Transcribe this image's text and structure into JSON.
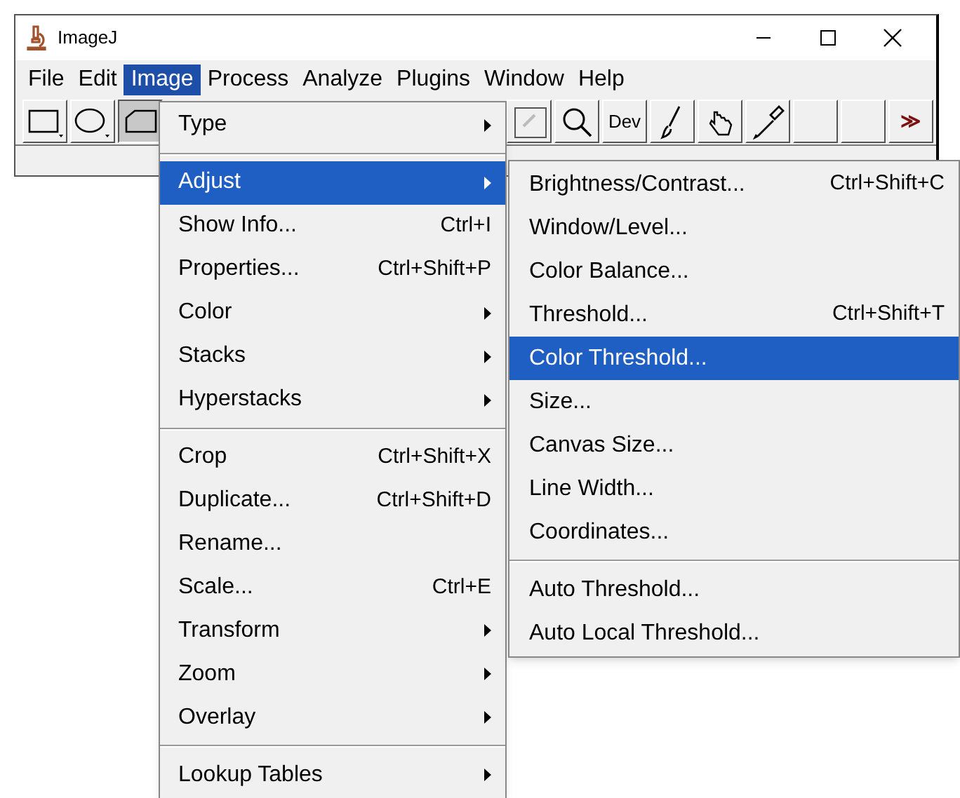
{
  "window": {
    "title": "ImageJ"
  },
  "menu_bar": [
    {
      "label": "File",
      "selected": false
    },
    {
      "label": "Edit",
      "selected": false
    },
    {
      "label": "Image",
      "selected": true
    },
    {
      "label": "Process",
      "selected": false
    },
    {
      "label": "Analyze",
      "selected": false
    },
    {
      "label": "Plugins",
      "selected": false
    },
    {
      "label": "Window",
      "selected": false
    },
    {
      "label": "Help",
      "selected": false
    }
  ],
  "toolbar_left": [
    {
      "kind": "rectangle",
      "selected": false
    },
    {
      "kind": "oval",
      "selected": false
    },
    {
      "kind": "polygon",
      "selected": true
    }
  ],
  "toolbar_right": [
    {
      "kind": "disabled",
      "selected": false
    },
    {
      "kind": "magnifier",
      "selected": false
    },
    {
      "kind": "text",
      "label": "Dev",
      "selected": false
    },
    {
      "kind": "brush",
      "selected": false
    },
    {
      "kind": "hand",
      "selected": false
    },
    {
      "kind": "pipette",
      "selected": false
    },
    {
      "kind": "blank",
      "selected": false
    },
    {
      "kind": "blank",
      "selected": false
    },
    {
      "kind": "more",
      "label": "≫",
      "selected": false
    }
  ],
  "image_menu": [
    {
      "kind": "item",
      "label": "Type",
      "submenu": true,
      "selected": false
    },
    {
      "kind": "separator"
    },
    {
      "kind": "item",
      "label": "Adjust",
      "submenu": true,
      "selected": true
    },
    {
      "kind": "item",
      "label": "Show Info...",
      "shortcut": "Ctrl+I",
      "selected": false
    },
    {
      "kind": "item",
      "label": "Properties...",
      "shortcut": "Ctrl+Shift+P",
      "selected": false
    },
    {
      "kind": "item",
      "label": "Color",
      "submenu": true,
      "selected": false
    },
    {
      "kind": "item",
      "label": "Stacks",
      "submenu": true,
      "selected": false
    },
    {
      "kind": "item",
      "label": "Hyperstacks",
      "submenu": true,
      "selected": false
    },
    {
      "kind": "separator"
    },
    {
      "kind": "item",
      "label": "Crop",
      "shortcut": "Ctrl+Shift+X",
      "selected": false
    },
    {
      "kind": "item",
      "label": "Duplicate...",
      "shortcut": "Ctrl+Shift+D",
      "selected": false
    },
    {
      "kind": "item",
      "label": "Rename...",
      "selected": false
    },
    {
      "kind": "item",
      "label": "Scale...",
      "shortcut": "Ctrl+E",
      "selected": false
    },
    {
      "kind": "item",
      "label": "Transform",
      "submenu": true,
      "selected": false
    },
    {
      "kind": "item",
      "label": "Zoom",
      "submenu": true,
      "selected": false
    },
    {
      "kind": "item",
      "label": "Overlay",
      "submenu": true,
      "selected": false
    },
    {
      "kind": "separator"
    },
    {
      "kind": "item",
      "label": "Lookup Tables",
      "submenu": true,
      "selected": false
    }
  ],
  "adjust_submenu": [
    {
      "kind": "item",
      "label": "Brightness/Contrast...",
      "shortcut": "Ctrl+Shift+C",
      "selected": false
    },
    {
      "kind": "item",
      "label": "Window/Level...",
      "selected": false
    },
    {
      "kind": "item",
      "label": "Color Balance...",
      "selected": false
    },
    {
      "kind": "item",
      "label": "Threshold...",
      "shortcut": "Ctrl+Shift+T",
      "selected": false
    },
    {
      "kind": "item",
      "label": "Color Threshold...",
      "selected": true
    },
    {
      "kind": "item",
      "label": "Size...",
      "selected": false
    },
    {
      "kind": "item",
      "label": "Canvas Size...",
      "selected": false
    },
    {
      "kind": "item",
      "label": "Line Width...",
      "selected": false
    },
    {
      "kind": "item",
      "label": "Coordinates...",
      "selected": false
    },
    {
      "kind": "separator"
    },
    {
      "kind": "item",
      "label": "Auto Threshold...",
      "selected": false
    },
    {
      "kind": "item",
      "label": "Auto Local Threshold...",
      "selected": false
    }
  ]
}
